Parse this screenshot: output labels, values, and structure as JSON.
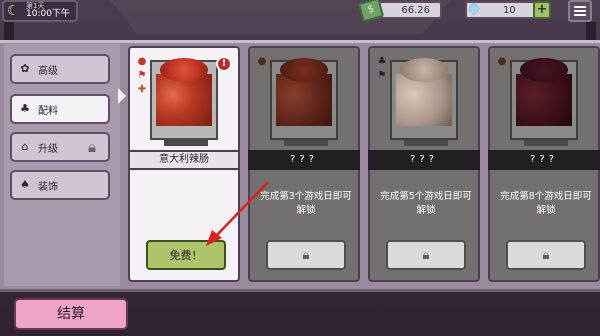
{
  "top_bar": {
    "day_label": "第1天",
    "time": "10:00下午",
    "money": "66.26",
    "gems": "10",
    "gem_plus": "+"
  },
  "sidebar": {
    "tabs": [
      {
        "label": "高级",
        "icon": "gear-icon",
        "active": false,
        "locked": false
      },
      {
        "label": "配料",
        "icon": "mushroom-icon",
        "active": true,
        "locked": false
      },
      {
        "label": "升级",
        "icon": "house-icon",
        "active": false,
        "locked": true
      },
      {
        "label": "装饰",
        "icon": "plant-icon",
        "active": false,
        "locked": false
      }
    ]
  },
  "cards": [
    {
      "name": "意大利辣肠",
      "desc": "",
      "button": "免费！",
      "locked": false
    },
    {
      "name": "???",
      "desc": "完成第3个游戏日即可解锁",
      "button": "",
      "locked": true
    },
    {
      "name": "???",
      "desc": "完成第5个游戏日即可解锁",
      "button": "",
      "locked": true
    },
    {
      "name": "???",
      "desc": "完成第8个游戏日即可解锁",
      "button": "",
      "locked": true
    }
  ],
  "footer": {
    "checkout_label": "结算"
  },
  "colors": {
    "accent_pink": "#f0a3c8",
    "free_green": "#aec46a",
    "alert_red": "#c0262b"
  }
}
